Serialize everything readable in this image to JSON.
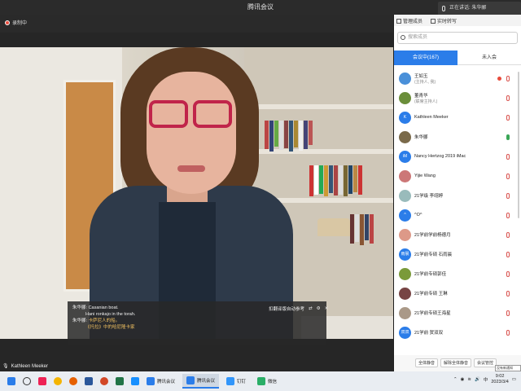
{
  "window": {
    "title": "腾讯会议"
  },
  "speaking": {
    "text": "正在讲话: 朱华郦"
  },
  "recording": {
    "label": "录制中"
  },
  "subtitle": {
    "line1_speaker": "朱华郦:",
    "line1_text": "Casanian boat.",
    "line2_text": "Hani ronkajo in the torah.",
    "line3_speaker": "朱华郦:",
    "line3_text": "卡萨尼人的船。",
    "line4_text": "《托拉》中的哈尼隆卡家",
    "control_label": "扣翻译版自动参考"
  },
  "speaker_name": "Kathleen Meeker",
  "panel": {
    "tab_members": "管理成员",
    "tab_transcript": "实时转写",
    "search_placeholder": "搜索成员",
    "seg_in": "会议中(167)",
    "seg_out": "未入会"
  },
  "members": [
    {
      "name": "王如玉",
      "role": "(主持人, 我)",
      "avatar_color": "#4a90d9",
      "mic": "muted",
      "rec": true
    },
    {
      "name": "董青华",
      "role": "(联席主持人)",
      "avatar_color": "#6b8e3a",
      "mic": "muted",
      "rec": false
    },
    {
      "name": "Kathleen Meeker",
      "role": "",
      "avatar_color": "#2b7de9",
      "avatar_text": "K",
      "mic": "muted",
      "rec": false
    },
    {
      "name": "朱华郦",
      "role": "",
      "avatar_color": "#7a6a4a",
      "mic": "on",
      "rec": false
    },
    {
      "name": "Nancy Hertzog 2019 iMac",
      "role": "",
      "avatar_color": "#2b7de9",
      "avatar_text": "iM",
      "mic": "muted",
      "rec": false
    },
    {
      "name": "Yijie Wang",
      "role": "",
      "avatar_color": "#c77",
      "mic": "muted",
      "rec": false
    },
    {
      "name": "21学级 李翊婷",
      "role": "",
      "avatar_color": "#9bb",
      "mic": "muted",
      "rec": false
    },
    {
      "name": "^O^",
      "role": "",
      "avatar_color": "#2b7de9",
      "avatar_text": "^",
      "mic": "muted",
      "rec": false
    },
    {
      "name": "21学前学前杨德月",
      "role": "",
      "avatar_color": "#d98",
      "mic": "muted",
      "rec": false
    },
    {
      "name": "21学前专硕 石雨晨",
      "role": "",
      "avatar_color": "#2b7de9",
      "avatar_text": "雨晨",
      "mic": "muted",
      "rec": false
    },
    {
      "name": "21学前专硕郭佳",
      "role": "",
      "avatar_color": "#7a9a3a",
      "mic": "muted",
      "rec": false
    },
    {
      "name": "21学前专硕 王琳",
      "role": "",
      "avatar_color": "#744",
      "mic": "muted",
      "rec": false
    },
    {
      "name": "21学前专硕王海星",
      "role": "",
      "avatar_color": "#a98",
      "mic": "muted",
      "rec": false
    },
    {
      "name": "21学前 贺双双",
      "role": "",
      "avatar_color": "#2b7de9",
      "avatar_text": "双双",
      "mic": "muted",
      "rec": false
    }
  ],
  "footer": {
    "mute_all": "全体静音",
    "unmute_all": "解除全体静音",
    "meeting_control": "会议管控"
  },
  "tooltip": "没有新通知",
  "taskbar": {
    "apps": [
      {
        "label": "腾讯会议",
        "color": "#2b7de9",
        "active": false
      },
      {
        "label": "腾讯会议",
        "color": "#2b7de9",
        "active": true
      },
      {
        "label": "钉钉",
        "color": "#3296fa",
        "active": false
      },
      {
        "label": "微信",
        "color": "#2aae67",
        "active": false
      }
    ],
    "time": "9:02",
    "date": "2023/3/4"
  }
}
